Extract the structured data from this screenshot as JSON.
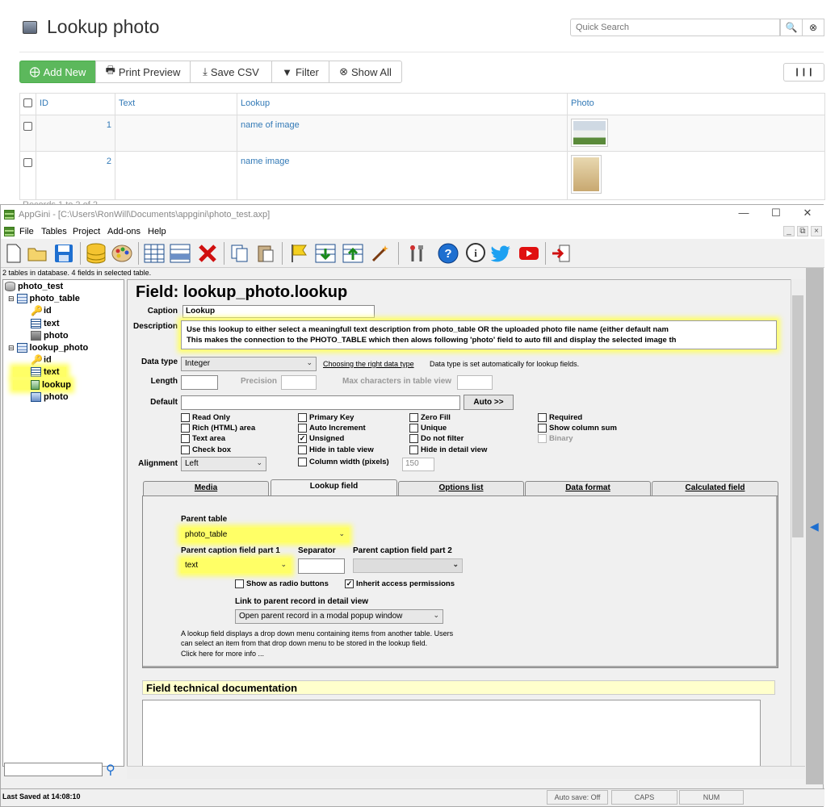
{
  "web": {
    "title": "Lookup photo",
    "search_placeholder": "Quick Search",
    "buttons": {
      "add_new": "Add New",
      "print_preview": "Print Preview",
      "save_csv": "Save CSV",
      "filter": "Filter",
      "show_all": "Show All"
    },
    "table": {
      "headers": [
        "ID",
        "Text",
        "Lookup",
        "Photo"
      ],
      "rows": [
        {
          "id": "1",
          "text": "",
          "lookup": "name of image"
        },
        {
          "id": "2",
          "text": "",
          "lookup": "name image"
        }
      ]
    },
    "footer_cut": "Records 1 to 2 of 2"
  },
  "app": {
    "title": "AppGini - [C:\\Users\\RonWill\\Documents\\appgini\\photo_test.axp]",
    "menu": [
      "File",
      "Tables",
      "Project",
      "Add-ons",
      "Help"
    ],
    "status_top": "2 tables in database. 4 fields in selected table.",
    "tree": {
      "db": "photo_test",
      "tables": [
        {
          "name": "photo_table",
          "fields": [
            "id",
            "text",
            "photo"
          ]
        },
        {
          "name": "lookup_photo",
          "fields": [
            "id",
            "text",
            "lookup",
            "photo"
          ]
        }
      ]
    },
    "field": {
      "heading": "Field: lookup_photo.lookup",
      "caption_label": "Caption",
      "caption_value": "Lookup",
      "description_label": "Description",
      "description_line1": "Use this lookup to either select a meaningfull text description from photo_table OR the uploaded photo file name (either default nam",
      "description_line2": "This makes the connection to the PHOTO_TABLE which then alows following 'photo' field to auto fill and display the selected image th",
      "datatype_label": "Data type",
      "datatype_value": "Integer",
      "datatype_link": "Choosing the right data type",
      "datatype_note": "Data type is set automatically for lookup fields.",
      "length_label": "Length",
      "precision_label": "Precision",
      "maxchars_label": "Max characters in table view",
      "default_label": "Default",
      "auto_button": "Auto >>",
      "alignment_label": "Alignment",
      "alignment_value": "Left",
      "colwidth_value": "150",
      "checkboxes": {
        "read_only": "Read Only",
        "rich_html": "Rich (HTML) area",
        "text_area": "Text area",
        "check_box": "Check box",
        "primary_key": "Primary Key",
        "auto_increment": "Auto Increment",
        "unsigned": "Unsigned",
        "hide_table": "Hide in table view",
        "column_width": "Column width (pixels)",
        "zero_fill": "Zero Fill",
        "unique": "Unique",
        "do_not_filter": "Do not filter",
        "hide_detail": "Hide in detail view",
        "required": "Required",
        "show_sum": "Show column sum",
        "binary": "Binary"
      },
      "tabs": [
        "Media",
        "Lookup field",
        "Options list",
        "Data format",
        "Calculated field"
      ],
      "lookup": {
        "parent_table_label": "Parent table",
        "parent_table_value": "photo_table",
        "caption1_label": "Parent caption field part 1",
        "caption1_value": "text",
        "separator_label": "Separator",
        "caption2_label": "Parent caption field part 2",
        "show_radio": "Show as radio buttons",
        "inherit": "Inherit access permissions",
        "link_label": "Link to parent record in detail view",
        "link_value": "Open parent record in a modal popup window",
        "help_line1": "A lookup field displays a drop down menu containing items from another table. Users",
        "help_line2": "can select an item from that drop down menu to be stored in the lookup field.",
        "more_info": "Click here for more info ..."
      },
      "doc_title": "Field technical documentation"
    },
    "statusbar": {
      "saved": "Last Saved at 14:08:10",
      "autosave": "Auto save: Off",
      "caps": "CAPS",
      "num": "NUM"
    }
  }
}
